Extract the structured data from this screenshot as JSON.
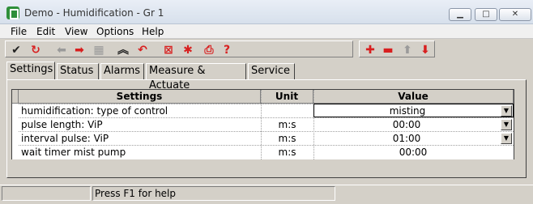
{
  "window": {
    "title": "Demo - Humidification - Gr 1",
    "minimize": "▁",
    "maximize": "□",
    "close": "✕"
  },
  "menu": [
    "File",
    "Edit",
    "View",
    "Options",
    "Help"
  ],
  "toolbar": {
    "left_icons": [
      "check-icon",
      "refresh-icon",
      "arrow-left-icon",
      "arrow-right-icon",
      "grid-icon",
      "collapse-icon",
      "undo-icon",
      "delete-icon",
      "asterisk-icon",
      "print-icon",
      "help-icon"
    ],
    "right_icons": [
      "add-icon",
      "remove-icon",
      "move-up-icon",
      "move-down-icon"
    ]
  },
  "tabs": [
    "Settings",
    "Status",
    "Alarms",
    "Measure & Actuate",
    "Service"
  ],
  "active_tab": "Settings",
  "grid": {
    "columns": [
      "Settings",
      "Unit",
      "Value"
    ],
    "rows": [
      {
        "setting": "humidification: type of control",
        "unit": "",
        "value": "misting",
        "dropdown": true,
        "selected": true
      },
      {
        "setting": "pulse length: ViP",
        "unit": "m:s",
        "value": "00:00",
        "dropdown": true,
        "selected": false
      },
      {
        "setting": "interval pulse: ViP",
        "unit": "m:s",
        "value": "01:00",
        "dropdown": true,
        "selected": false
      },
      {
        "setting": "wait timer mist pump",
        "unit": "m:s",
        "value": "00:00",
        "dropdown": false,
        "selected": false
      }
    ]
  },
  "status": {
    "help": "Press F1 for help"
  }
}
